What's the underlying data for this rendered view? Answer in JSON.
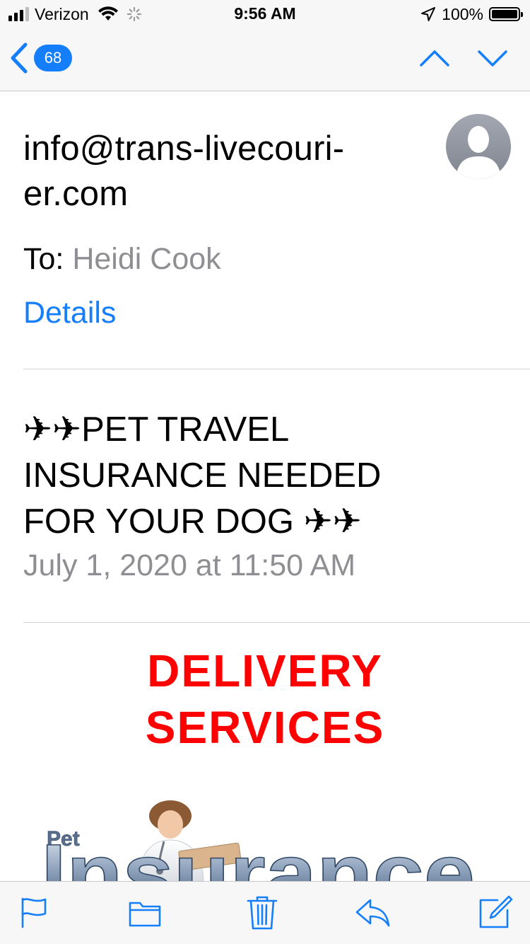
{
  "status_bar": {
    "carrier": "Verizon",
    "time": "9:56 AM",
    "battery_percent": "100%",
    "signal_bars_filled": 3,
    "signal_bars_total": 4,
    "battery_level": 1.0
  },
  "nav": {
    "unread_count": "68",
    "accent_color": "#147efb"
  },
  "message": {
    "sender": "info@trans-livecouri-er.com",
    "sender_line1": "info@trans-livecouri-",
    "sender_line2": "er.com",
    "to_label": "To:",
    "to_name": "Heidi Cook",
    "details_label": "Details",
    "subject": "✈✈PET TRAVEL INSURANCE NEEDED FOR YOUR DOG ✈✈",
    "subject_line1": "✈✈PET TRAVEL",
    "subject_line2": "INSURANCE NEEDED",
    "subject_line3": "FOR YOUR DOG ✈✈",
    "date": "July 1, 2020 at 11:50 AM"
  },
  "body": {
    "headline_line1": "DELIVERY",
    "headline_line2": "SERVICES",
    "headline_color": "#ff0000",
    "ad_small_text": "Pet",
    "ad_large_text": "Insurance"
  },
  "toolbar": {
    "icons": [
      "flag-icon",
      "folder-icon",
      "trash-icon",
      "reply-icon",
      "compose-icon"
    ]
  }
}
